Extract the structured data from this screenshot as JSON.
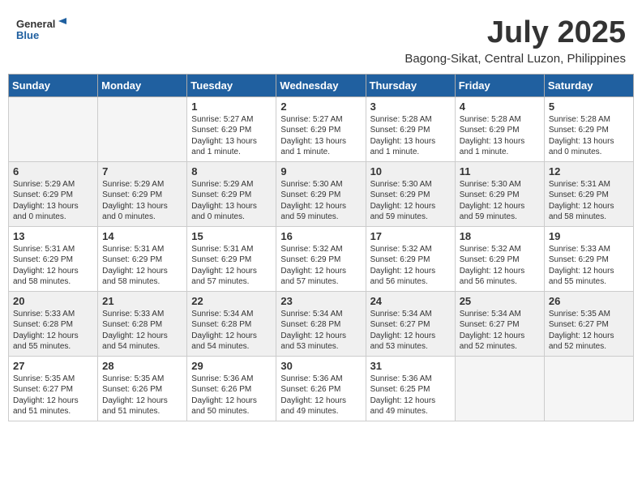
{
  "header": {
    "logo_line1": "General",
    "logo_line2": "Blue",
    "month": "July 2025",
    "location": "Bagong-Sikat, Central Luzon, Philippines"
  },
  "days_of_week": [
    "Sunday",
    "Monday",
    "Tuesday",
    "Wednesday",
    "Thursday",
    "Friday",
    "Saturday"
  ],
  "weeks": [
    [
      {
        "day": "",
        "info": ""
      },
      {
        "day": "",
        "info": ""
      },
      {
        "day": "1",
        "info": "Sunrise: 5:27 AM\nSunset: 6:29 PM\nDaylight: 13 hours and 1 minute."
      },
      {
        "day": "2",
        "info": "Sunrise: 5:27 AM\nSunset: 6:29 PM\nDaylight: 13 hours and 1 minute."
      },
      {
        "day": "3",
        "info": "Sunrise: 5:28 AM\nSunset: 6:29 PM\nDaylight: 13 hours and 1 minute."
      },
      {
        "day": "4",
        "info": "Sunrise: 5:28 AM\nSunset: 6:29 PM\nDaylight: 13 hours and 1 minute."
      },
      {
        "day": "5",
        "info": "Sunrise: 5:28 AM\nSunset: 6:29 PM\nDaylight: 13 hours and 0 minutes."
      }
    ],
    [
      {
        "day": "6",
        "info": "Sunrise: 5:29 AM\nSunset: 6:29 PM\nDaylight: 13 hours and 0 minutes."
      },
      {
        "day": "7",
        "info": "Sunrise: 5:29 AM\nSunset: 6:29 PM\nDaylight: 13 hours and 0 minutes."
      },
      {
        "day": "8",
        "info": "Sunrise: 5:29 AM\nSunset: 6:29 PM\nDaylight: 13 hours and 0 minutes."
      },
      {
        "day": "9",
        "info": "Sunrise: 5:30 AM\nSunset: 6:29 PM\nDaylight: 12 hours and 59 minutes."
      },
      {
        "day": "10",
        "info": "Sunrise: 5:30 AM\nSunset: 6:29 PM\nDaylight: 12 hours and 59 minutes."
      },
      {
        "day": "11",
        "info": "Sunrise: 5:30 AM\nSunset: 6:29 PM\nDaylight: 12 hours and 59 minutes."
      },
      {
        "day": "12",
        "info": "Sunrise: 5:31 AM\nSunset: 6:29 PM\nDaylight: 12 hours and 58 minutes."
      }
    ],
    [
      {
        "day": "13",
        "info": "Sunrise: 5:31 AM\nSunset: 6:29 PM\nDaylight: 12 hours and 58 minutes."
      },
      {
        "day": "14",
        "info": "Sunrise: 5:31 AM\nSunset: 6:29 PM\nDaylight: 12 hours and 58 minutes."
      },
      {
        "day": "15",
        "info": "Sunrise: 5:31 AM\nSunset: 6:29 PM\nDaylight: 12 hours and 57 minutes."
      },
      {
        "day": "16",
        "info": "Sunrise: 5:32 AM\nSunset: 6:29 PM\nDaylight: 12 hours and 57 minutes."
      },
      {
        "day": "17",
        "info": "Sunrise: 5:32 AM\nSunset: 6:29 PM\nDaylight: 12 hours and 56 minutes."
      },
      {
        "day": "18",
        "info": "Sunrise: 5:32 AM\nSunset: 6:29 PM\nDaylight: 12 hours and 56 minutes."
      },
      {
        "day": "19",
        "info": "Sunrise: 5:33 AM\nSunset: 6:29 PM\nDaylight: 12 hours and 55 minutes."
      }
    ],
    [
      {
        "day": "20",
        "info": "Sunrise: 5:33 AM\nSunset: 6:28 PM\nDaylight: 12 hours and 55 minutes."
      },
      {
        "day": "21",
        "info": "Sunrise: 5:33 AM\nSunset: 6:28 PM\nDaylight: 12 hours and 54 minutes."
      },
      {
        "day": "22",
        "info": "Sunrise: 5:34 AM\nSunset: 6:28 PM\nDaylight: 12 hours and 54 minutes."
      },
      {
        "day": "23",
        "info": "Sunrise: 5:34 AM\nSunset: 6:28 PM\nDaylight: 12 hours and 53 minutes."
      },
      {
        "day": "24",
        "info": "Sunrise: 5:34 AM\nSunset: 6:27 PM\nDaylight: 12 hours and 53 minutes."
      },
      {
        "day": "25",
        "info": "Sunrise: 5:34 AM\nSunset: 6:27 PM\nDaylight: 12 hours and 52 minutes."
      },
      {
        "day": "26",
        "info": "Sunrise: 5:35 AM\nSunset: 6:27 PM\nDaylight: 12 hours and 52 minutes."
      }
    ],
    [
      {
        "day": "27",
        "info": "Sunrise: 5:35 AM\nSunset: 6:27 PM\nDaylight: 12 hours and 51 minutes."
      },
      {
        "day": "28",
        "info": "Sunrise: 5:35 AM\nSunset: 6:26 PM\nDaylight: 12 hours and 51 minutes."
      },
      {
        "day": "29",
        "info": "Sunrise: 5:36 AM\nSunset: 6:26 PM\nDaylight: 12 hours and 50 minutes."
      },
      {
        "day": "30",
        "info": "Sunrise: 5:36 AM\nSunset: 6:26 PM\nDaylight: 12 hours and 49 minutes."
      },
      {
        "day": "31",
        "info": "Sunrise: 5:36 AM\nSunset: 6:25 PM\nDaylight: 12 hours and 49 minutes."
      },
      {
        "day": "",
        "info": ""
      },
      {
        "day": "",
        "info": ""
      }
    ]
  ]
}
